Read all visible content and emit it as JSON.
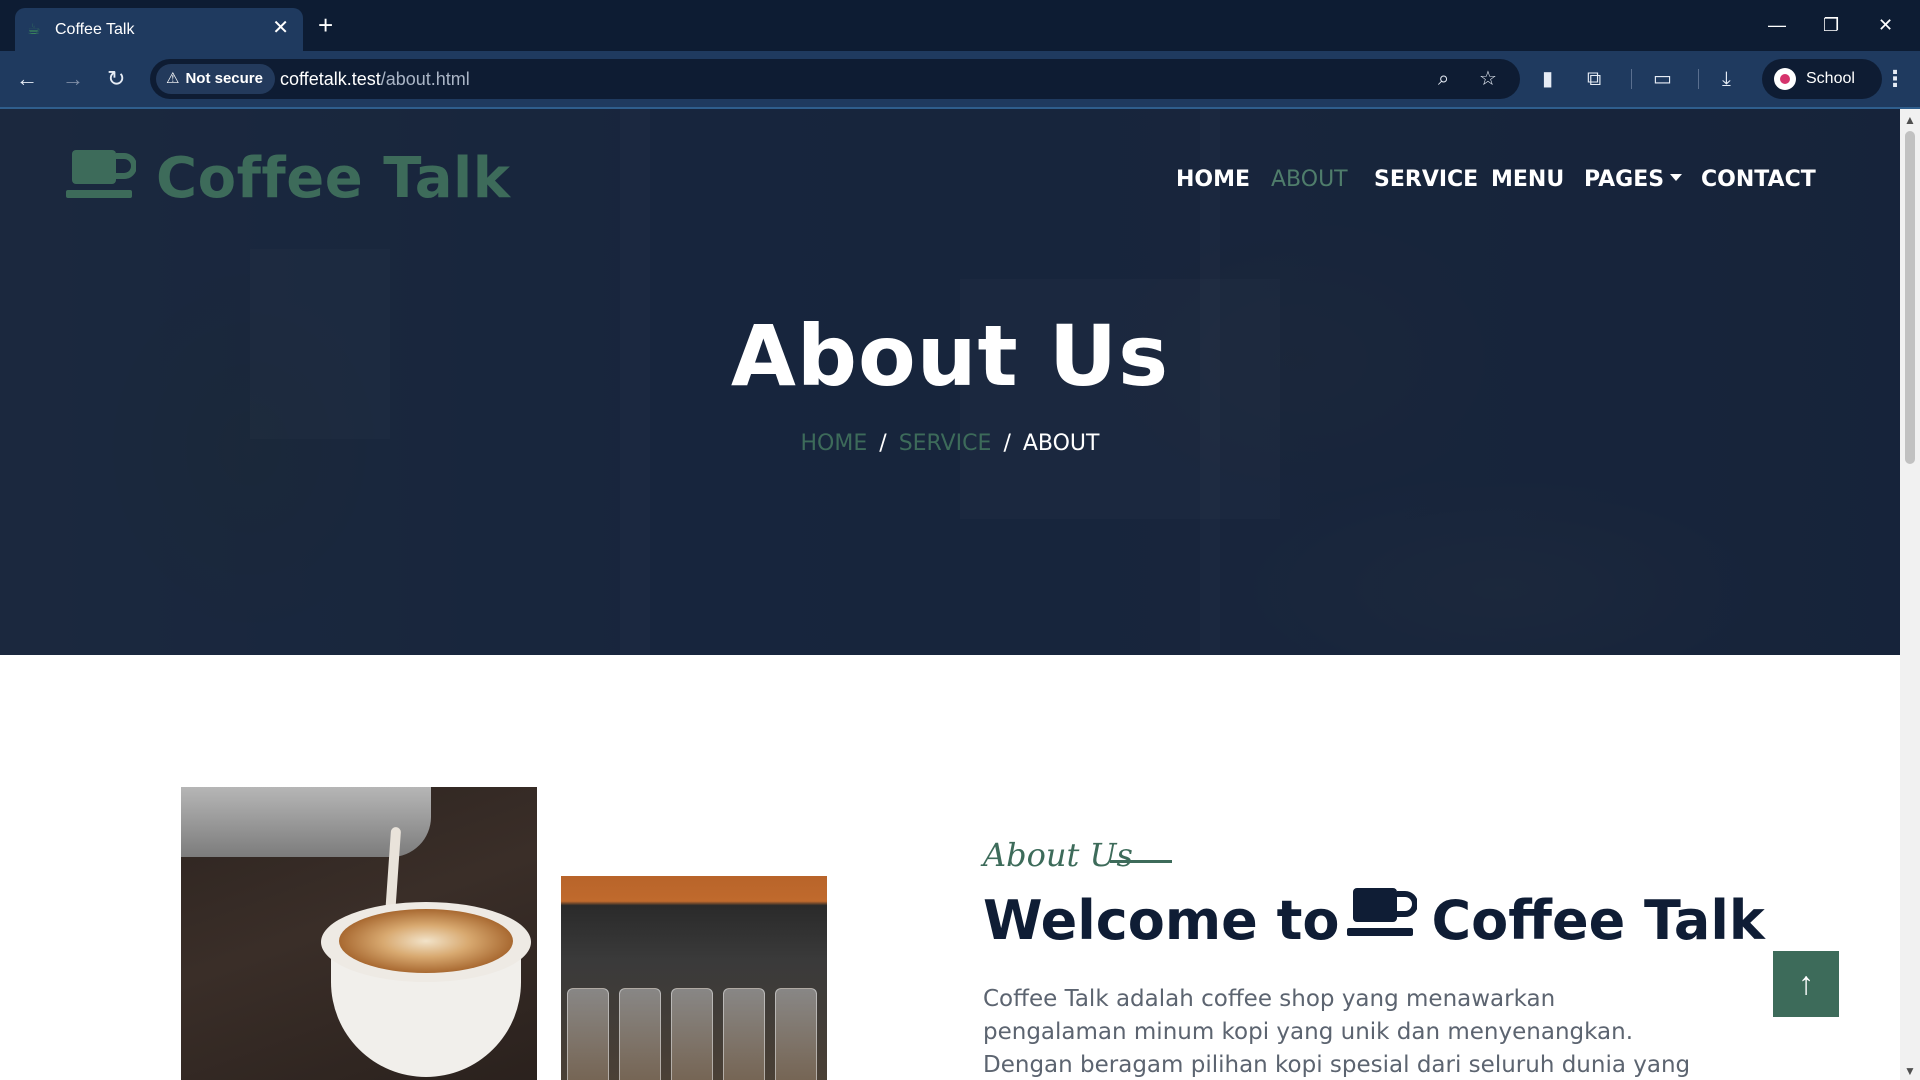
{
  "browser": {
    "tab_title": "Coffee Talk",
    "tab_close": "✕",
    "new_tab": "+",
    "window_minimize": "—",
    "window_restore": "❐",
    "window_close": "✕",
    "security_label": "Not secure",
    "url_host": "coffetalk.test",
    "url_path": "/about.html",
    "profile_name": "School"
  },
  "site": {
    "brand": "Coffee Talk",
    "nav": [
      {
        "label": "HOME"
      },
      {
        "label": "ABOUT",
        "active": true
      },
      {
        "label": "SERVICE"
      },
      {
        "label": "MENU"
      },
      {
        "label": "PAGES",
        "dropdown": true
      },
      {
        "label": "CONTACT"
      }
    ]
  },
  "hero": {
    "title": "About Us",
    "breadcrumb": {
      "home": "HOME",
      "service": "SERVICE",
      "current": "ABOUT",
      "separator": "/"
    }
  },
  "about": {
    "subtitle": "About Us",
    "heading_prefix": "Welcome to",
    "heading_brand": "Coffee Talk",
    "text": "Coffee Talk adalah coffee shop yang menawarkan pengalaman minum kopi yang unik dan menyenangkan. Dengan beragam pilihan kopi spesial dari seluruh dunia yang disajikan oleh barista"
  },
  "back_to_top": "↑",
  "colors": {
    "brand_green": "#3d6b5a",
    "navy": "#0f1d35",
    "chrome_tab": "#1f3a5f"
  },
  "icons": [
    "coffee-cup-icon",
    "warning-icon",
    "search-zoom-icon",
    "star-icon",
    "extensions-icon",
    "download-icon",
    "arrow-up-icon"
  ]
}
